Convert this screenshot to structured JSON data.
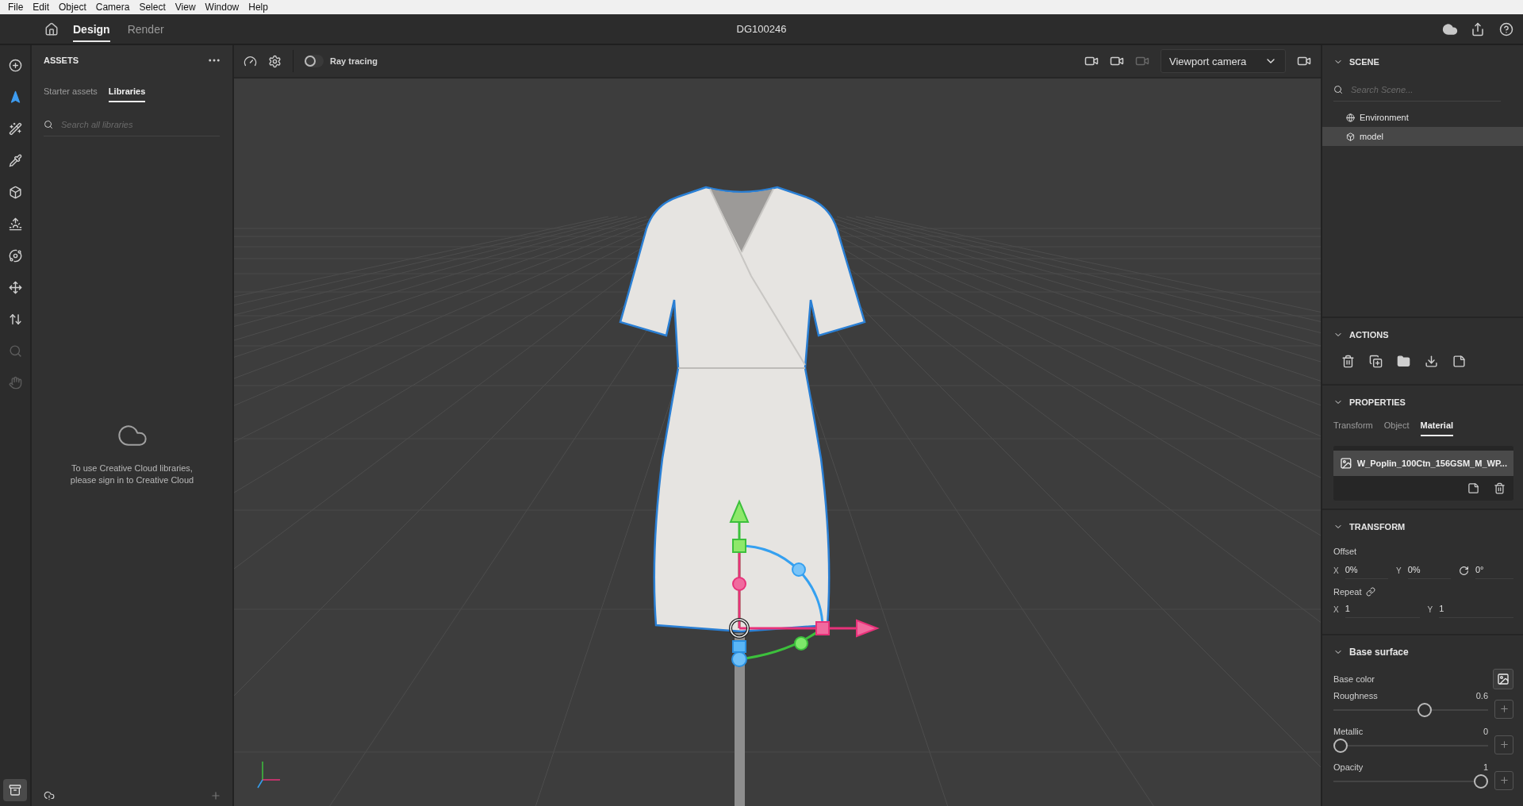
{
  "menu": [
    "File",
    "Edit",
    "Object",
    "Camera",
    "Select",
    "View",
    "Window",
    "Help"
  ],
  "header": {
    "tabs": [
      {
        "label": "Design",
        "selected": true
      },
      {
        "label": "Render",
        "selected": false
      }
    ],
    "title": "DG100246"
  },
  "tools": [
    {
      "kind": "add",
      "selected": false,
      "disabled": false
    },
    {
      "kind": "select",
      "selected": true,
      "disabled": false
    },
    {
      "kind": "magic",
      "selected": false,
      "disabled": false
    },
    {
      "kind": "eyedropper",
      "selected": false,
      "disabled": false
    },
    {
      "kind": "cube",
      "selected": false,
      "disabled": false
    },
    {
      "kind": "light",
      "selected": false,
      "disabled": false
    },
    {
      "kind": "orbit",
      "selected": false,
      "disabled": false
    },
    {
      "kind": "move",
      "selected": false,
      "disabled": false
    },
    {
      "kind": "vertical",
      "selected": false,
      "disabled": false
    },
    {
      "kind": "zoom",
      "selected": false,
      "disabled": true
    },
    {
      "kind": "hand",
      "selected": false,
      "disabled": true
    }
  ],
  "bottom_tool": {
    "selected": true
  },
  "assets": {
    "title": "ASSETS",
    "tabs": [
      {
        "label": "Starter assets",
        "selected": false
      },
      {
        "label": "Libraries",
        "selected": true
      }
    ],
    "search": {
      "placeholder": "Search all libraries"
    },
    "message": "To use Creative Cloud libraries, please sign in to Creative Cloud"
  },
  "viewport": {
    "ray_tracing": {
      "label": "Ray tracing",
      "on": false
    },
    "camera": "Viewport camera"
  },
  "scene": {
    "title": "SCENE",
    "search": {
      "placeholder": "Search Scene..."
    },
    "items": [
      {
        "label": "Environment",
        "kind": "environment",
        "selected": false
      },
      {
        "label": "model",
        "kind": "model",
        "selected": true
      }
    ]
  },
  "actions": {
    "title": "ACTIONS"
  },
  "properties": {
    "title": "PROPERTIES",
    "tabs": [
      {
        "label": "Transform",
        "selected": false
      },
      {
        "label": "Object",
        "selected": false
      },
      {
        "label": "Material",
        "selected": true
      }
    ],
    "material": "W_Poplin_100Ctn_156GSM_M_WP..."
  },
  "transform": {
    "title": "TRANSFORM",
    "offset_label": "Offset",
    "offset": [
      {
        "label": "X",
        "value": "0%"
      },
      {
        "label": "Y",
        "value": "0%"
      }
    ],
    "rotation": "0°",
    "repeat_label": "Repeat",
    "repeat": [
      {
        "label": "X",
        "value": "1"
      },
      {
        "label": "Y",
        "value": "1"
      }
    ]
  },
  "base_surface": {
    "title": "Base surface",
    "base_color_label": "Base color",
    "sliders": [
      {
        "label": "Roughness",
        "value": "0.6",
        "level": 0.6
      },
      {
        "label": "Metallic",
        "value": "0",
        "level": 0
      },
      {
        "label": "Opacity",
        "value": "1",
        "level": 1
      }
    ]
  }
}
